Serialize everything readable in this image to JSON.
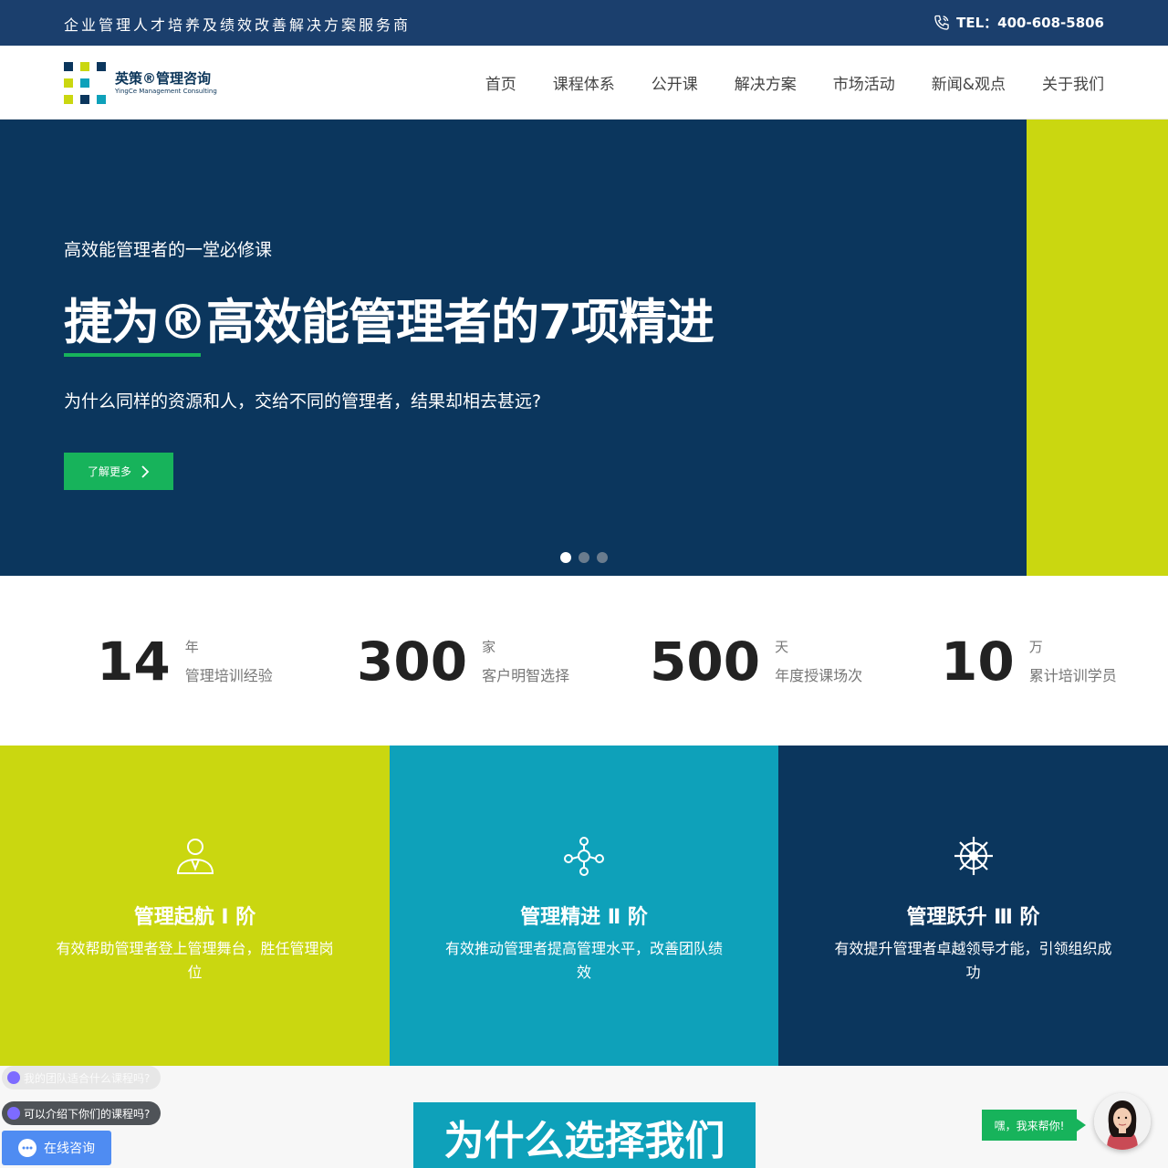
{
  "topbar": {
    "slogan": "企业管理人才培养及绩效改善解决方案服务商",
    "tel": "TEL：400-608-5806"
  },
  "logo": {
    "name_cn": "英策®管理咨询",
    "name_en": "YingCe Management Consulting"
  },
  "nav": [
    {
      "label": "首页"
    },
    {
      "label": "课程体系"
    },
    {
      "label": "公开课"
    },
    {
      "label": "解决方案"
    },
    {
      "label": "市场活动"
    },
    {
      "label": "新闻&观点"
    },
    {
      "label": "关于我们"
    }
  ],
  "hero": {
    "kicker": "高效能管理者的一堂必修课",
    "title": "捷为®高效能管理者的7项精进",
    "desc": "为什么同样的资源和人，交给不同的管理者，结果却相去甚远?",
    "button": "了解更多",
    "slides": 3,
    "active_slide": 1
  },
  "stats": [
    {
      "num": "14",
      "unit": "年",
      "label": "管理培训经验"
    },
    {
      "num": "300",
      "unit": "家",
      "label": "客户明智选择"
    },
    {
      "num": "500",
      "unit": "天",
      "label": "年度授课场次"
    },
    {
      "num": "10",
      "unit": "万",
      "label": "累计培训学员"
    }
  ],
  "tiers": [
    {
      "name": "管理起航 Ⅰ 阶",
      "desc": "有效帮助管理者登上管理舞台，胜任管理岗位",
      "color": "#cad710",
      "icon": "manager-icon"
    },
    {
      "name": "管理精进 Ⅱ 阶",
      "desc": "有效推动管理者提高管理水平，改善团队绩效",
      "color": "#0ea1ba",
      "icon": "team-icon"
    },
    {
      "name": "管理跃升 Ⅲ 阶",
      "desc": "有效提升管理者卓越领导才能，引领组织成功",
      "color": "#0b365d",
      "icon": "helm-icon"
    }
  ],
  "why": {
    "title": "为什么选择我们"
  },
  "chat": {
    "faded_question": "我的团队适合什么课程吗?",
    "question": "可以介绍下你们的课程吗?",
    "consult": "在线咨询",
    "help": "嘿，我来帮你!"
  },
  "colors": {
    "navy": "#0b365d",
    "topbar": "#1b3f6d",
    "lime": "#cad710",
    "teal": "#0ea1ba",
    "green": "#17b35b"
  }
}
